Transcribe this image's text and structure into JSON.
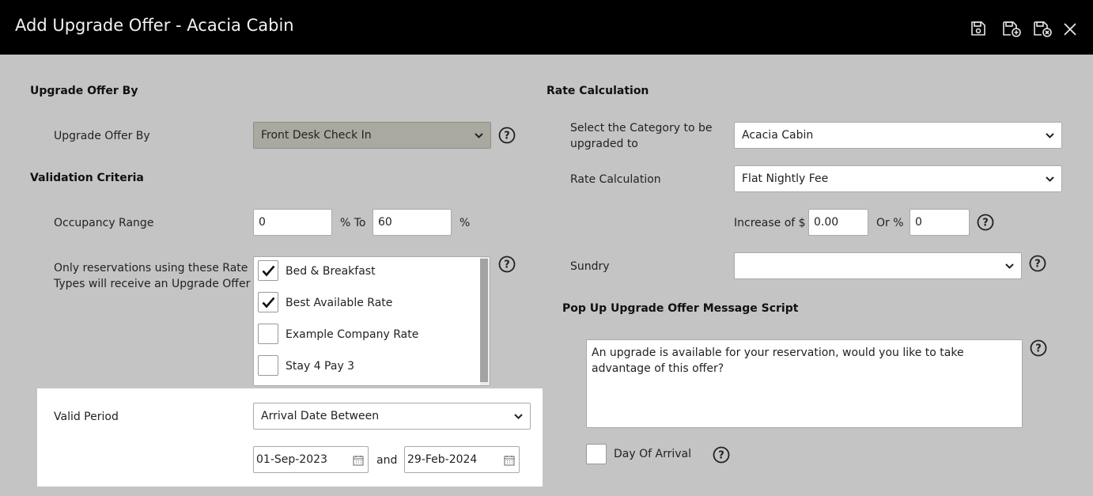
{
  "window": {
    "title": "Add Upgrade Offer - Acacia Cabin"
  },
  "toolbar": {
    "icons": [
      "save-icon",
      "save-and-new-icon",
      "save-and-close-icon",
      "close-icon"
    ]
  },
  "left": {
    "upgrade_offer_section": "Upgrade Offer By",
    "upgrade_offer_label": "Upgrade Offer By",
    "upgrade_offer_value": "Front Desk Check In",
    "validation_section": "Validation Criteria",
    "occupancy_label": "Occupancy Range",
    "occupancy_from": "0",
    "occupancy_to_text": "% To",
    "occupancy_to": "60",
    "occupancy_pct": "%",
    "rate_types_label_1": "Only reservations using these Rate",
    "rate_types_label_2": "Types will receive an Upgrade Offer",
    "rate_types": [
      {
        "label": "Bed & Breakfast",
        "checked": true
      },
      {
        "label": "Best Available Rate",
        "checked": true
      },
      {
        "label": "Example Company Rate",
        "checked": false
      },
      {
        "label": "Stay 4 Pay 3",
        "checked": false
      }
    ],
    "valid_period_label": "Valid Period",
    "valid_period_value": "Arrival Date Between",
    "date_from": "01-Sep-2023",
    "and_text": "and",
    "date_to": "29-Feb-2024"
  },
  "right": {
    "rate_calc_section": "Rate Calculation",
    "category_label_1": "Select the Category to be",
    "category_label_2": "upgraded to",
    "category_value": "Acacia Cabin",
    "rate_calc_label": "Rate Calculation",
    "rate_calc_value": "Flat Nightly Fee",
    "increase_label": "Increase of $",
    "increase_value": "0.00",
    "or_pct_label": "Or %",
    "or_pct_value": "0",
    "sundry_label": "Sundry",
    "sundry_value": "",
    "popup_section": "Pop Up Upgrade Offer Message Script",
    "popup_message": "An upgrade is available for your reservation, would you like to take advantage of this offer?",
    "day_of_arrival_label": "Day Of Arrival",
    "day_of_arrival_checked": false
  }
}
